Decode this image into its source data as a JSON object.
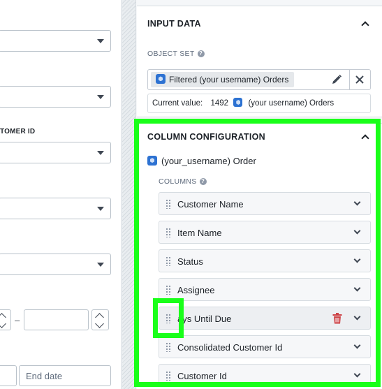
{
  "left_form": {
    "field_label_customer_id": "TOMER ID",
    "range_dash": "–",
    "end_date_placeholder": "End date"
  },
  "input_data": {
    "title": "INPUT DATA",
    "object_set_label": "OBJECT SET",
    "object_set_tag": "Filtered (your username) Orders",
    "current_value_label": "Current value:",
    "current_value_count": "1492",
    "current_value_object": "(your username) Orders"
  },
  "column_configuration": {
    "title": "COLUMN CONFIGURATION",
    "object_type": "(your_username) Order",
    "columns_label": "COLUMNS",
    "columns": [
      {
        "label": "Customer Name"
      },
      {
        "label": "Item Name"
      },
      {
        "label": "Status"
      },
      {
        "label": "Assignee"
      },
      {
        "label": "ays Until Due"
      },
      {
        "label": "Consolidated Customer Id"
      },
      {
        "label": "Customer Id"
      }
    ]
  },
  "colors": {
    "highlight": "#19ff19",
    "accent": "#2d72d2",
    "danger": "#cd4246"
  },
  "icons": {
    "help": "help-icon",
    "object": "cube-icon",
    "edit": "pencil-icon",
    "clear": "close-icon",
    "drag": "drag-handle-icon",
    "delete": "trash-icon",
    "expand": "chevron-down-icon",
    "collapse": "chevron-up-icon"
  }
}
